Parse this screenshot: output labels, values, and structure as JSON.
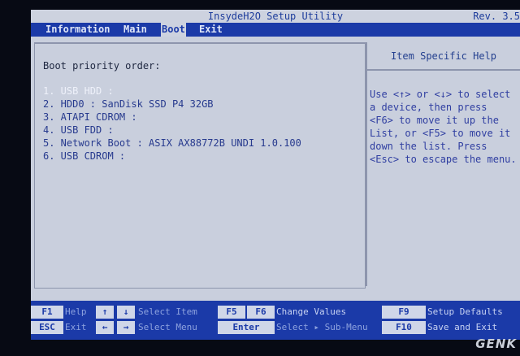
{
  "window": {
    "title": "InsydeH2O Setup Utility",
    "revision": "Rev. 3.5"
  },
  "tabs": [
    {
      "label": "Information"
    },
    {
      "label": "Main"
    },
    {
      "label": "Boot",
      "active": true
    },
    {
      "label": "Exit"
    }
  ],
  "boot": {
    "section_title": "Boot priority order:",
    "items": [
      {
        "label": "1. USB HDD :"
      },
      {
        "label": "2. HDD0 : SanDisk SSD P4 32GB"
      },
      {
        "label": "3. ATAPI CDROM :"
      },
      {
        "label": "4. USB FDD :"
      },
      {
        "label": "5. Network Boot : ASIX AX88772B UNDI 1.0.100"
      },
      {
        "label": "6. USB CDROM :"
      }
    ],
    "selected_index": 0
  },
  "help": {
    "title": "Item Specific Help",
    "lines": [
      "Use <↑> or <↓> to select",
      "a device, then press",
      "<F6> to move it up the",
      "List, or <F5> to move it",
      "down the list. Press",
      "<Esc> to escape the menu."
    ]
  },
  "footer": {
    "keys": [
      {
        "key": "F1",
        "desc": "Help"
      },
      {
        "key": "ESC",
        "desc": "Exit"
      },
      {
        "key": "↑",
        "key2": "↓",
        "desc": "Select Item"
      },
      {
        "key": "←",
        "key2": "→",
        "desc": "Select Menu"
      },
      {
        "key": "F5",
        "key2": "F6",
        "desc": "Change Values"
      },
      {
        "key": "Enter",
        "desc": "Select ▸ Sub-Menu"
      },
      {
        "key": "F9",
        "desc": "Setup Defaults"
      },
      {
        "key": "F10",
        "desc": "Save and Exit"
      }
    ]
  },
  "watermark": "GENK",
  "colors": {
    "background": "#c9cfdd",
    "accent_blue": "#1b3aa8",
    "selected_item": "#eef1fa"
  }
}
